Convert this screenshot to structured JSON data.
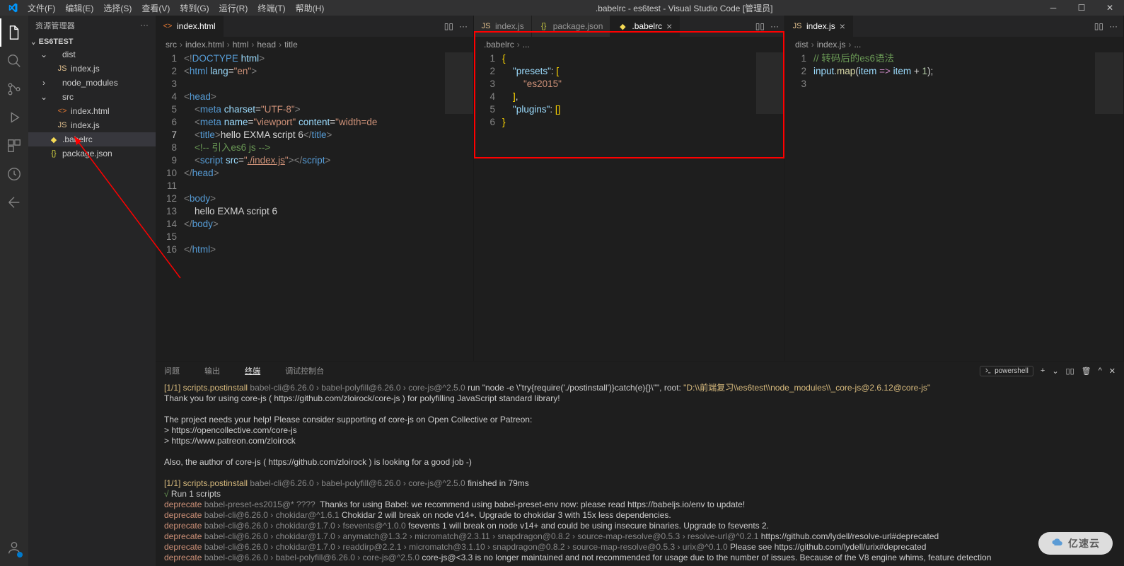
{
  "title": ".babelrc - es6test - Visual Studio Code [管理员]",
  "menu": [
    "文件(F)",
    "编辑(E)",
    "选择(S)",
    "查看(V)",
    "转到(G)",
    "运行(R)",
    "终端(T)",
    "帮助(H)"
  ],
  "sidebar": {
    "title": "资源管理器",
    "project": "ES6TEST",
    "items": [
      {
        "label": "dist",
        "depth": 0,
        "expanded": true,
        "type": "folder"
      },
      {
        "label": "index.js",
        "depth": 1,
        "type": "js"
      },
      {
        "label": "node_modules",
        "depth": 0,
        "expanded": false,
        "type": "folder"
      },
      {
        "label": "src",
        "depth": 0,
        "expanded": true,
        "type": "folder"
      },
      {
        "label": "index.html",
        "depth": 1,
        "type": "html"
      },
      {
        "label": "index.js",
        "depth": 1,
        "type": "js"
      },
      {
        "label": ".babelrc",
        "depth": 0,
        "type": "babel",
        "selected": true
      },
      {
        "label": "package.json",
        "depth": 0,
        "type": "json"
      }
    ]
  },
  "editors": {
    "col1": {
      "tabs": [
        {
          "label": "index.html",
          "icon": "html",
          "active": true
        }
      ],
      "breadcrumbs": [
        "src",
        "index.html",
        "html",
        "head",
        "title"
      ],
      "lines": [
        {
          "n": 1,
          "html": "<span class='punc'>&lt;!</span><span class='tag'>DOCTYPE</span> <span class='attr'>html</span><span class='punc'>&gt;</span>"
        },
        {
          "n": 2,
          "html": "<span class='punc'>&lt;</span><span class='tag'>html</span> <span class='attr'>lang</span>=<span class='str'>\"en\"</span><span class='punc'>&gt;</span>"
        },
        {
          "n": 3,
          "html": ""
        },
        {
          "n": 4,
          "html": "<span class='punc'>&lt;</span><span class='tag'>head</span><span class='punc'>&gt;</span>"
        },
        {
          "n": 5,
          "html": "    <span class='punc'>&lt;</span><span class='tag'>meta</span> <span class='attr'>charset</span>=<span class='str'>\"UTF-8\"</span><span class='punc'>&gt;</span>"
        },
        {
          "n": 6,
          "html": "    <span class='punc'>&lt;</span><span class='tag'>meta</span> <span class='attr'>name</span>=<span class='str'>\"viewport\"</span> <span class='attr'>content</span>=<span class='str'>\"width=de</span>"
        },
        {
          "n": 7,
          "html": "    <span class='punc'>&lt;</span><span class='tag'>title</span><span class='punc'>&gt;</span>hello EXMA script 6<span class='punc'>&lt;/</span><span class='tag'>title</span><span class='punc'>&gt;</span>",
          "cur": true
        },
        {
          "n": 8,
          "html": "    <span class='cm'>&lt;!-- 引入es6 js --&gt;</span>"
        },
        {
          "n": 9,
          "html": "    <span class='punc'>&lt;</span><span class='tag'>script</span> <span class='attr'>src</span>=<span class='str'>\"<u>./index.js</u>\"</span><span class='punc'>&gt;&lt;/</span><span class='tag'>script</span><span class='punc'>&gt;</span>"
        },
        {
          "n": 10,
          "html": "<span class='punc'>&lt;/</span><span class='tag'>head</span><span class='punc'>&gt;</span>"
        },
        {
          "n": 11,
          "html": ""
        },
        {
          "n": 12,
          "html": "<span class='punc'>&lt;</span><span class='tag'>body</span><span class='punc'>&gt;</span>"
        },
        {
          "n": 13,
          "html": "    hello EXMA script 6"
        },
        {
          "n": 14,
          "html": "<span class='punc'>&lt;/</span><span class='tag'>body</span><span class='punc'>&gt;</span>"
        },
        {
          "n": 15,
          "html": ""
        },
        {
          "n": 16,
          "html": "<span class='punc'>&lt;/</span><span class='tag'>html</span><span class='punc'>&gt;</span>"
        }
      ]
    },
    "col2": {
      "tabs": [
        {
          "label": "index.js",
          "icon": "js"
        },
        {
          "label": "package.json",
          "icon": "json"
        },
        {
          "label": ".babelrc",
          "icon": "babel",
          "active": true,
          "close": true
        }
      ],
      "breadcrumbs": [
        ".babelrc",
        "..."
      ],
      "lines": [
        {
          "n": 1,
          "html": "<span class='brace'>{</span>"
        },
        {
          "n": 2,
          "html": "    <span class='attr'>\"presets\"</span>: <span class='brace'>[</span>"
        },
        {
          "n": 3,
          "html": "        <span class='str'>\"es2015\"</span>"
        },
        {
          "n": 4,
          "html": "    <span class='brace'>]</span>,"
        },
        {
          "n": 5,
          "html": "    <span class='attr'>\"plugins\"</span>: <span class='brace'>[]</span>"
        },
        {
          "n": 6,
          "html": "<span class='brace'>}</span>"
        }
      ],
      "highlight": true
    },
    "col3": {
      "tabs": [
        {
          "label": "index.js",
          "icon": "js",
          "active": true,
          "close": true
        }
      ],
      "breadcrumbs": [
        "dist",
        "index.js",
        "..."
      ],
      "lines": [
        {
          "n": 1,
          "html": "<span class='cm'>// 转码后的es6语法</span>"
        },
        {
          "n": 2,
          "html": "<span class='var'>input</span>.<span class='fn'>map</span>(<span class='var'>item</span> <span class='kw'>=&gt;</span> <span class='var'>item</span> + <span class='num'>1</span>);"
        },
        {
          "n": 3,
          "html": ""
        }
      ]
    }
  },
  "panel": {
    "tabs": [
      "问题",
      "输出",
      "终端",
      "调试控制台"
    ],
    "active": 2,
    "shell": "powershell",
    "lines": [
      "<span class='ylw'>[1/1] scripts.postinstall</span> <span class='dim'>babel-cli@6.26.0 › babel-polyfill@6.26.0 › core-js@^2.5.0</span> run \"node -e \\\"try{require('./postinstall')}catch(e){}\\\"\", root: <span class='ylw'>\"D:\\\\前端复习\\\\es6test\\\\node_modules\\\\_core-js@2.6.12@core-js\"</span>",
      "Thank you for using core-js ( https://github.com/zloirock/core-js ) for polyfilling JavaScript standard library!",
      "",
      "The project needs your help! Please consider supporting of core-js on Open Collective or Patreon:",
      "&gt; https://opencollective.com/core-js",
      "&gt; https://www.patreon.com/zloirock",
      "",
      "Also, the author of core-js ( https://github.com/zloirock ) is looking for a good job -)",
      "",
      "<span class='ylw'>[1/1] scripts.postinstall</span> <span class='dim'>babel-cli@6.26.0 › babel-polyfill@6.26.0 › core-js@^2.5.0</span> finished in 79ms",
      "<span class='grn'>√</span> Run 1 scripts",
      "<span class='org'>deprecate</span> <span class='dim'>babel-preset-es2015@* ????</span>  Thanks for using Babel: we recommend using babel-preset-env now: please read https://babeljs.io/env to update!",
      "<span class='org'>deprecate</span> <span class='dim'>babel-cli@6.26.0 › chokidar@^1.6.1</span> Chokidar 2 will break on node v14+. Upgrade to chokidar 3 with 15x less dependencies.",
      "<span class='org'>deprecate</span> <span class='dim'>babel-cli@6.26.0 › chokidar@1.7.0 › fsevents@^1.0.0</span> fsevents 1 will break on node v14+ and could be using insecure binaries. Upgrade to fsevents 2.",
      "<span class='org'>deprecate</span> <span class='dim'>babel-cli@6.26.0 › chokidar@1.7.0 › anymatch@1.3.2 › micromatch@2.3.11 › snapdragon@0.8.2 › source-map-resolve@0.5.3 › resolve-url@^0.2.1</span> https://github.com/lydell/resolve-url#deprecated",
      "<span class='org'>deprecate</span> <span class='dim'>babel-cli@6.26.0 › chokidar@1.7.0 › readdirp@2.2.1 › micromatch@3.1.10 › snapdragon@0.8.2 › source-map-resolve@0.5.3 › urix@^0.1.0</span> Please see https://github.com/lydell/urix#deprecated",
      "<span class='org'>deprecate</span> <span class='dim'>babel-cli@6.26.0 › babel-polyfill@6.26.0 › core-js@^2.5.0</span> core-js@&lt;3.3 is no longer maintained and not recommended for usage due to the number of issues. Because of the V8 engine whims, feature detection"
    ]
  },
  "watermark": "亿速云"
}
